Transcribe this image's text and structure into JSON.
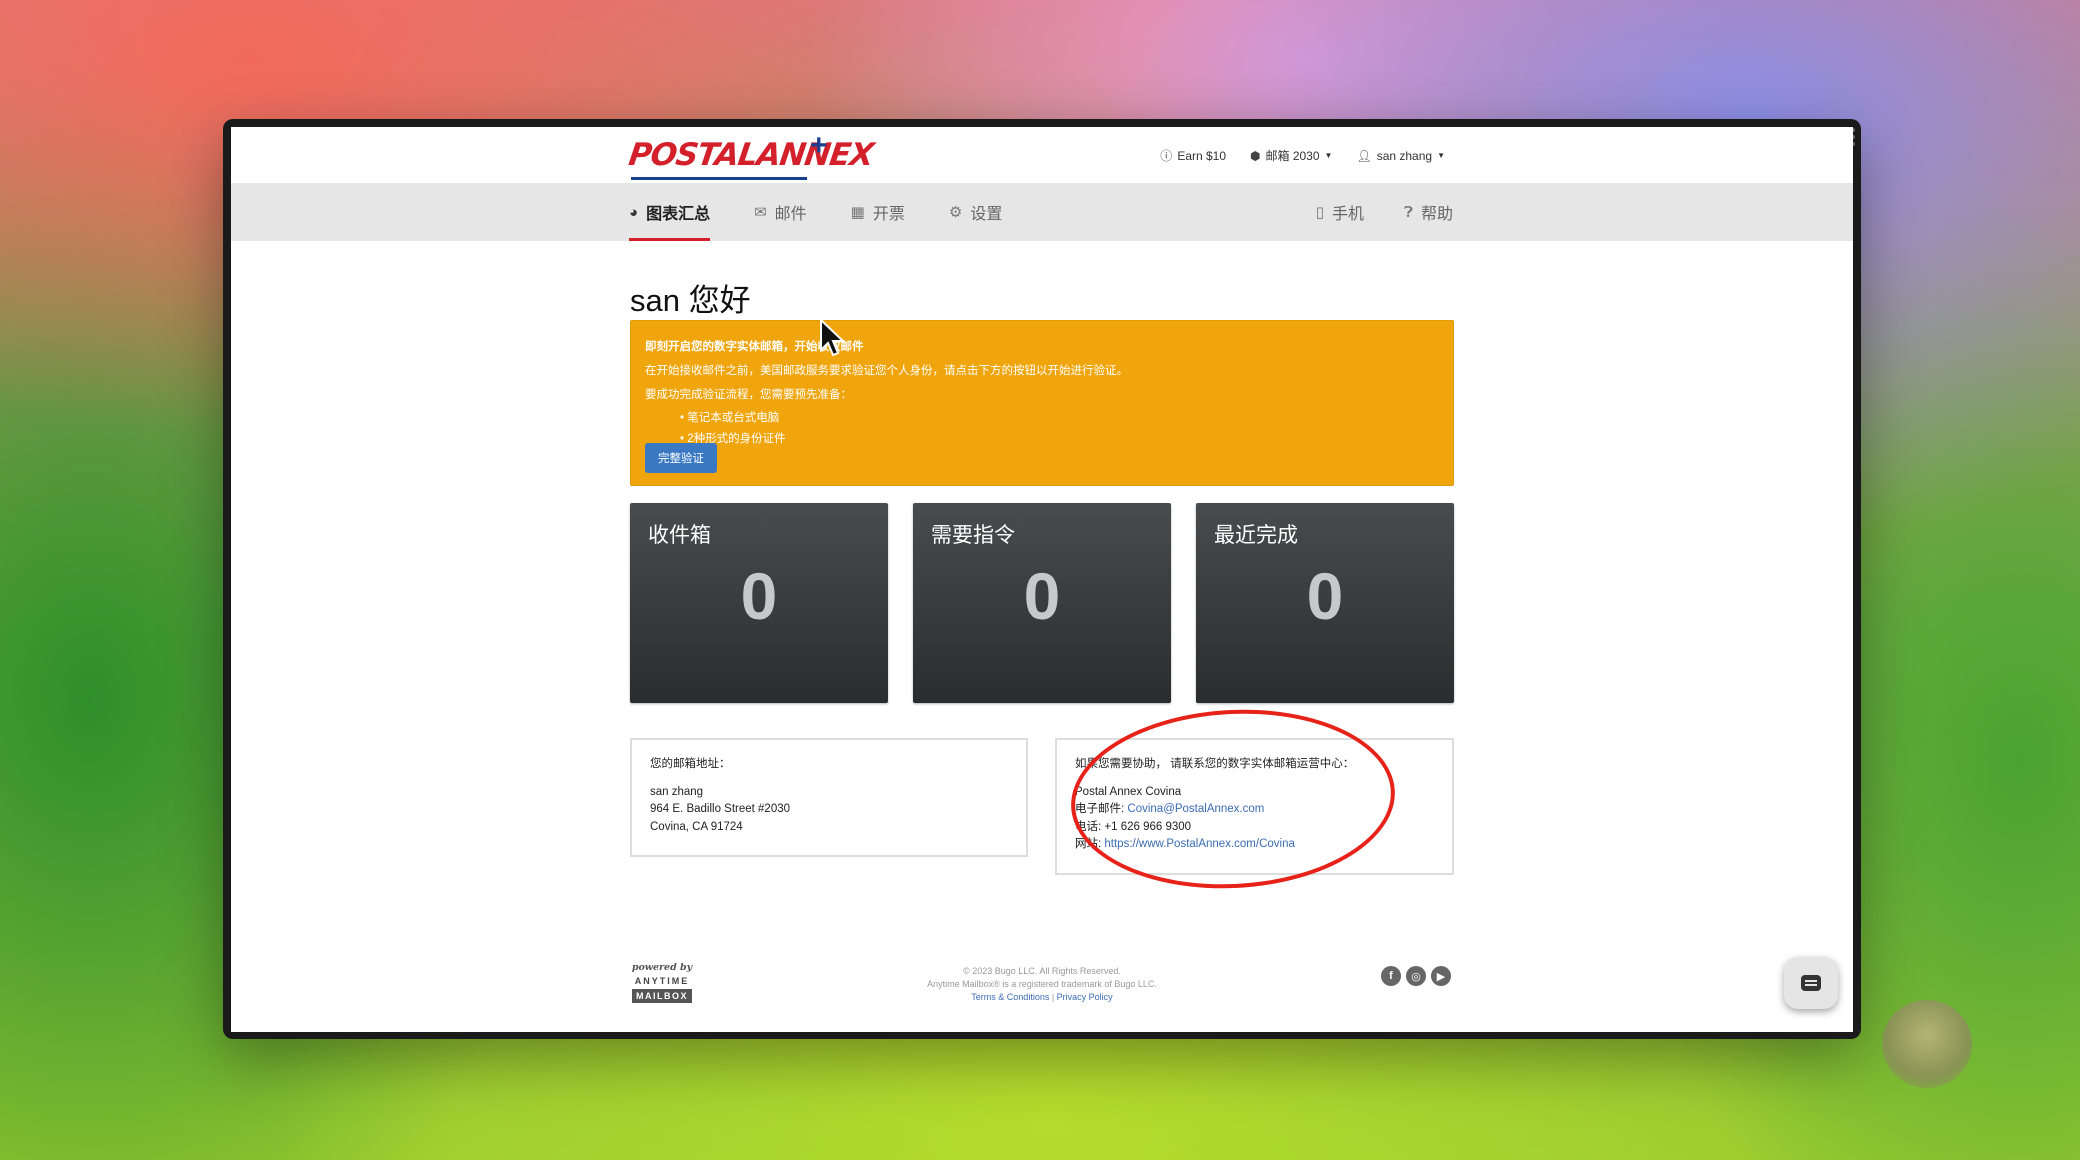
{
  "header": {
    "logo_text": "POSTALANNEX",
    "logo_plus": "+",
    "earn_label": "Earn $10",
    "mailbox_label": "邮箱 2030",
    "user_label": "san zhang"
  },
  "menu": {
    "left": [
      {
        "label": "图表汇总",
        "icon": "dashboard-icon",
        "active": true
      },
      {
        "label": "邮件",
        "icon": "envelope-icon"
      },
      {
        "label": "开票",
        "icon": "calculator-icon"
      },
      {
        "label": "设置",
        "icon": "gears-icon"
      }
    ],
    "right": [
      {
        "label": "手机",
        "icon": "mobile-icon"
      },
      {
        "label": "帮助",
        "icon": "question-circle-icon"
      }
    ]
  },
  "greeting": "san 您好",
  "alert": {
    "title": "即刻开启您的数字实体邮箱，开始收取邮件",
    "line1": "在开始接收邮件之前，美国邮政服务要求验证您个人身份，请点击下方的按钮以开始进行验证。",
    "line2": "要成功完成验证流程，您需要预先准备：",
    "items": [
      "笔记本或台式电脑",
      "2种形式的身份证件"
    ],
    "button": "完整验证"
  },
  "stats": [
    {
      "title": "收件箱",
      "value": "0"
    },
    {
      "title": "需要指令",
      "value": "0"
    },
    {
      "title": "最近完成",
      "value": "0"
    }
  ],
  "address": {
    "heading": "您的邮箱地址：",
    "name": "san zhang",
    "street": "964 E. Badillo Street #2030",
    "city": "Covina, CA 91724"
  },
  "support": {
    "heading": "如果您需要协助， 请联系您的数字实体邮箱运营中心：",
    "name": "Postal Annex Covina",
    "email_label": "电子邮件: ",
    "email": "Covina@PostalAnnex.com",
    "phone_label": "电话: ",
    "phone": "+1 626 966 9300",
    "website_label": "网站: ",
    "website": "https://www.PostalAnnex.com/Covina"
  },
  "footer": {
    "powered_by": "powered by",
    "anytime": "ANYTIME",
    "mailbox": "MAILBOX",
    "copyright": "© 2023 Bugo LLC. All Rights Reserved.",
    "trademark": "Anytime Mailbox® is a registered trademark of Bugo LLC.",
    "terms": "Terms & Conditions",
    "separator": " | ",
    "privacy": "Privacy Policy"
  },
  "colors": {
    "brand_red": "#d3202a",
    "alert_orange": "#f0a50d",
    "button_blue": "#3b78c4",
    "annotation_red": "#e62219"
  }
}
